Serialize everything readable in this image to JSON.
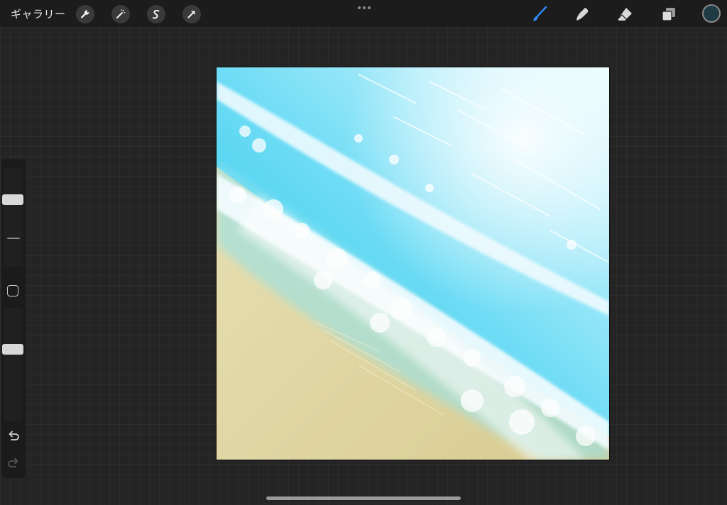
{
  "toolbar": {
    "gallery_label": "ギャラリー",
    "left_tools": [
      "wrench-icon",
      "magic-wand-icon",
      "selection-icon",
      "transform-arrow-icon"
    ],
    "right_tools": [
      "brush-icon",
      "smudge-icon",
      "eraser-icon",
      "layers-icon"
    ],
    "active_tool": "brush",
    "accent_color": "#2f8bff",
    "current_color": "#1f3b44"
  },
  "sidebar": {
    "brush_size_level": 0.3,
    "opacity_level": 0.35,
    "buttons": [
      "undo-icon",
      "redo-icon",
      "modify-square-icon"
    ]
  },
  "canvas": {
    "description_colors": {
      "water": "#3fd0ee",
      "foam": "#f4fcff",
      "sand": "#ddd29b"
    }
  }
}
